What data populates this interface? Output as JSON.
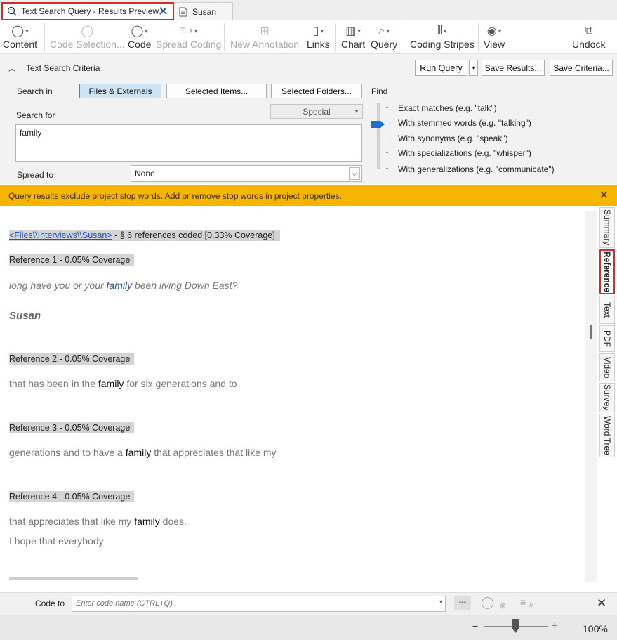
{
  "tabs": [
    {
      "label": "Text Search Query - Results Preview",
      "icon": "query-search-icon",
      "active": true
    },
    {
      "label": "Susan",
      "icon": "document-icon",
      "active": false
    }
  ],
  "toolbar": {
    "content": "Content",
    "code_selection": "Code Selection...",
    "code": "Code",
    "spread_coding": "Spread Coding",
    "new_annotation": "New Annotation",
    "links": "Links",
    "chart": "Chart",
    "query": "Query",
    "coding_stripes": "Coding Stripes",
    "view": "View",
    "undock": "Undock"
  },
  "criteria": {
    "header": "Text Search Criteria",
    "run_query": "Run Query",
    "save_results": "Save Results...",
    "save_criteria": "Save Criteria...",
    "search_in_label": "Search in",
    "search_in_options": [
      "Files & Externals",
      "Selected Items...",
      "Selected Folders..."
    ],
    "search_in_selected": "Files & Externals",
    "search_for_label": "Search for",
    "special_label": "Special",
    "search_for_value": "family",
    "spread_to_label": "Spread to",
    "spread_to_value": "None",
    "find_label": "Find",
    "find_options": [
      "Exact matches (e.g. \"talk\")",
      "With stemmed words (e.g. \"talking\")",
      "With synonyms (e.g. \"speak\")",
      "With specializations (e.g. \"whisper\")",
      "With generalizations (e.g. \"communicate\")"
    ],
    "find_selected_index": 1
  },
  "warning": {
    "text": "Query results exclude project stop words. Add or remove stop words in project properties."
  },
  "results": {
    "file_link": "<Files\\\\Interviews\\\\Susan>",
    "file_summary": " - § 6 references coded  [0.33% Coverage]",
    "references": [
      {
        "header": "Reference 1 - 0.05% Coverage",
        "before": "long have you or your ",
        "hit": "family",
        "after": " been living Down East?",
        "speaker": "Susan"
      },
      {
        "header": "Reference 2 - 0.05% Coverage",
        "before": "that has been in the ",
        "hit": "family",
        "after": " for six generations and to"
      },
      {
        "header": "Reference 3 - 0.05% Coverage",
        "before": "generations and to have a ",
        "hit": "family",
        "after": " that appreciates that like my"
      },
      {
        "header": "Reference 4 - 0.05% Coverage",
        "before": "that appreciates that like my ",
        "hit": "family",
        "after": " does.",
        "line2": "I hope that everybody"
      }
    ]
  },
  "side_tabs": [
    "Summary",
    "Reference",
    "Text",
    "PDF",
    "Video",
    "Survey",
    "Word Tree"
  ],
  "side_tab_active": "Reference",
  "code_bar": {
    "label": "Code to",
    "placeholder": "Enter code name (CTRL+Q)",
    "more": "•••"
  },
  "status": {
    "zoom": "100%",
    "zoom_minus": "−",
    "zoom_plus": "+"
  },
  "colors": {
    "warning": "#f7b500",
    "accent": "#1a6fd0",
    "highlight_border": "#d52b2b"
  }
}
